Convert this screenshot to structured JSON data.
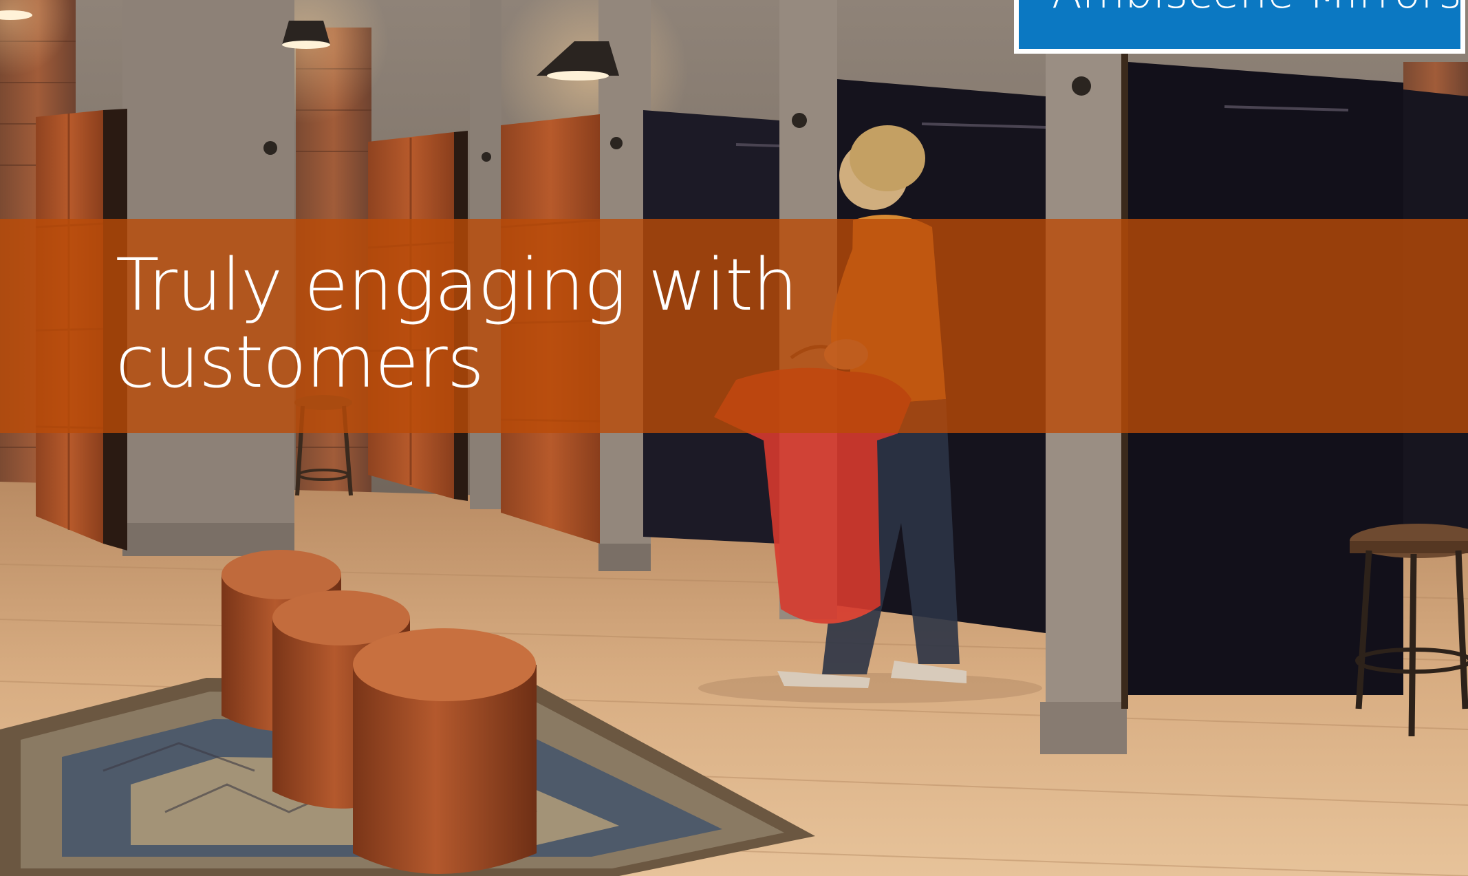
{
  "headline": {
    "line1": "Truly engaging with",
    "line2": "customers"
  },
  "badge": {
    "text": "Ambiscene Mirrors"
  },
  "colors": {
    "band": "#BA4B08",
    "badge": "#0B78C2",
    "headline_text": "#FFFFFF"
  },
  "photo": {
    "icons": [
      "leather-pouf-icon",
      "rug-icon",
      "fitting-room-curtain-icon",
      "pendant-lamp-icon",
      "bar-stool-icon"
    ]
  }
}
